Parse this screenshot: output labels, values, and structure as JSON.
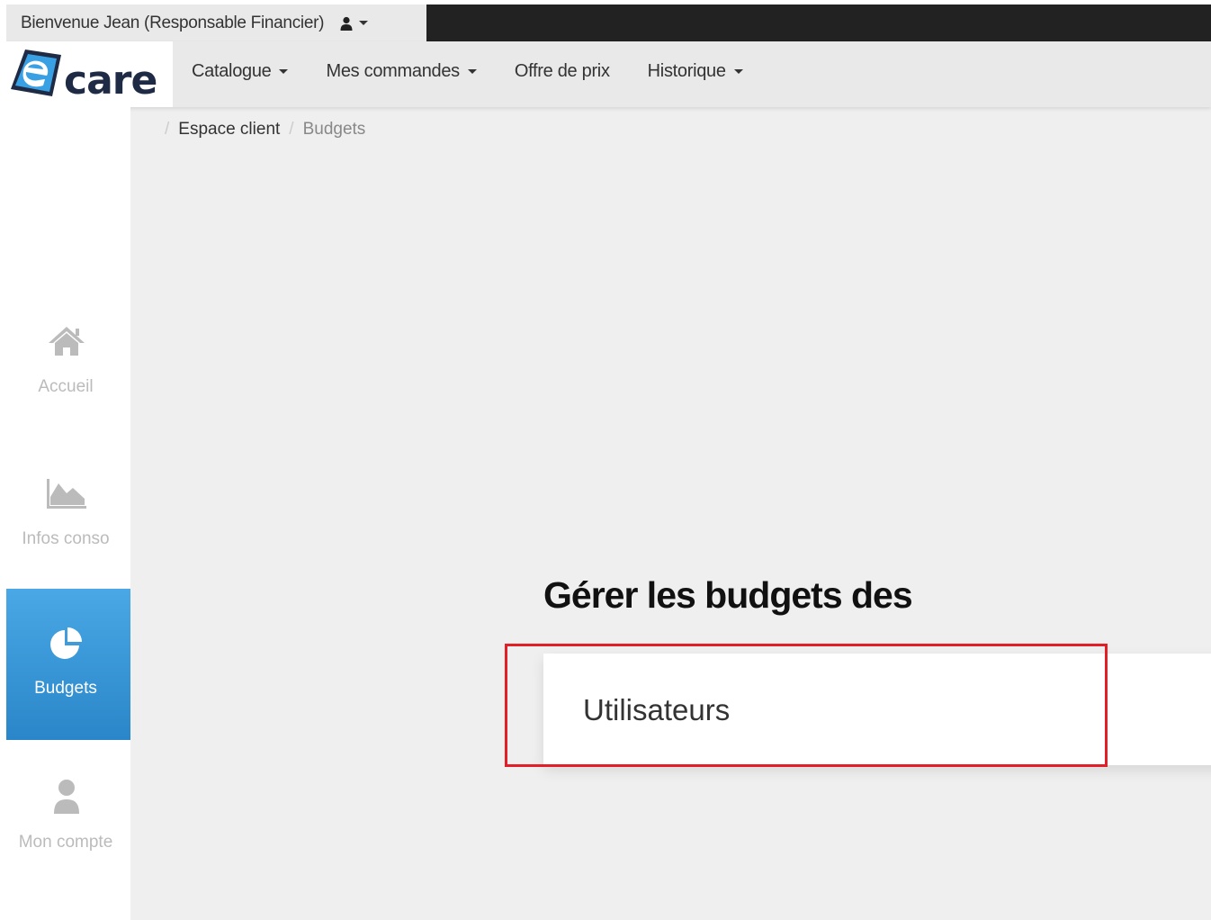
{
  "topbar": {
    "welcome_text": "Bienvenue Jean (Responsable Financier)",
    "user_icon": "user-icon"
  },
  "logo": {
    "text": "care",
    "icon": "e-logo-icon"
  },
  "nav": {
    "items": [
      {
        "label": "Catalogue",
        "dropdown": true
      },
      {
        "label": "Mes commandes",
        "dropdown": true
      },
      {
        "label": "Offre de prix",
        "dropdown": false
      },
      {
        "label": "Historique",
        "dropdown": true
      }
    ]
  },
  "breadcrumb": {
    "items": [
      "Espace client",
      "Budgets"
    ]
  },
  "sidebar": {
    "items": [
      {
        "label": "Accueil",
        "icon": "home-icon",
        "active": false
      },
      {
        "label": "Infos conso",
        "icon": "area-chart-icon",
        "active": false
      },
      {
        "label": "Budgets",
        "icon": "pie-chart-icon",
        "active": true
      },
      {
        "label": "Mon compte",
        "icon": "user-icon",
        "active": false
      }
    ]
  },
  "main": {
    "title": "Gérer les budgets des",
    "card_label": "Utilisateurs"
  },
  "colors": {
    "accent": "#2a86c8",
    "highlight": "#e41e26",
    "topbar_dark": "#222222",
    "background": "#efefef"
  }
}
